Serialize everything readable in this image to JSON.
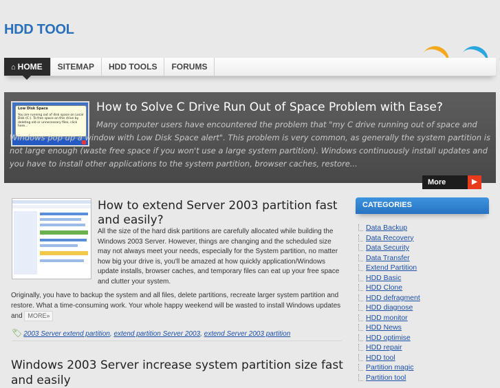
{
  "site": {
    "title": "HDD TOOL"
  },
  "nav": {
    "items": [
      {
        "label": "HOME",
        "icon": "home-icon"
      },
      {
        "label": "SITEMAP"
      },
      {
        "label": "HDD TOOLS"
      },
      {
        "label": "FORUMS"
      }
    ]
  },
  "featured": {
    "title": "How to Solve C Drive Run Out of Space Problem with Ease?",
    "excerpt": "Many computer users have encountered the problem that \"my C drive running out of space and Windows pop up a window with Low Disk Space alert\". This problem is very common, as generally the system partition is not large enough (waste free space if you won't use a large system partition). Windows continuously install updates and you have to install other applications to the system partition, browser caches, restore...",
    "more_label": "More",
    "thumb_title": "Low Disk Space",
    "thumb_text": "You are running out of disk space on Local Disk (C:). To free space on this drive by deleting old or unnecessary files, click here..."
  },
  "posts": [
    {
      "title": "How to extend Server 2003 partition fast and easily?",
      "excerpt": "All the size of the hard disk partitions are carefully allocated while building the Windows 2003 Server. However, things are changing and the scheduled size may not always meet your needs, especially for the System partition, no matter how big your drive is, you'll be amazed at how quickly application/Windows update installs, browser caches, and temporary files can eat up your free space and clutter your system.",
      "continued": "Originally, you have to backup the system and all files, delete partitions, recreate larger system partition and restore. What a time-consuming work. Your whole happy weekend will be wasted to install Windows updates and",
      "more_label": "MORE»",
      "tags": [
        "2003 Server extend partition",
        "extend partition Server 2003",
        "extend Server 2003 partition"
      ]
    },
    {
      "title": "Windows 2003 Server increase system partition size fast and easily"
    }
  ],
  "sidebar": {
    "categories_title": "CATEGORIES",
    "categories": [
      "Data Backup",
      "Data Recovery",
      "Data Security",
      "Data Transfer",
      "Extend Partition",
      "HDD Basic",
      "HDD Clone",
      "HDD defragment",
      "HDD diagnose",
      "HDD monitor",
      "HDD News",
      "HDD optimise",
      "HDD repair",
      "HDD tool",
      "Partition magic",
      "Partition tool"
    ]
  }
}
